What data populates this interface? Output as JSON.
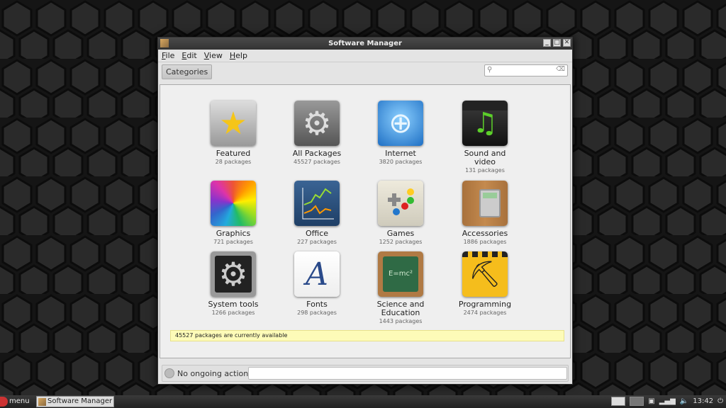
{
  "window": {
    "title": "Software Manager"
  },
  "menu": [
    "File",
    "Edit",
    "View",
    "Help"
  ],
  "toolbar": {
    "categories_label": "Categories",
    "search_placeholder": ""
  },
  "categories": [
    {
      "label": "Featured",
      "count": "28 packages",
      "icon": "star-icon"
    },
    {
      "label": "All Packages",
      "count": "45527 packages",
      "icon": "gear-icon"
    },
    {
      "label": "Internet",
      "count": "3820 packages",
      "icon": "globe-icon"
    },
    {
      "label": "Sound and video",
      "count": "131 packages",
      "icon": "clapper-music-icon"
    },
    {
      "label": "Graphics",
      "count": "721 packages",
      "icon": "color-wheel-icon"
    },
    {
      "label": "Office",
      "count": "227 packages",
      "icon": "chart-icon"
    },
    {
      "label": "Games",
      "count": "1252 packages",
      "icon": "gamepad-icon"
    },
    {
      "label": "Accessories",
      "count": "1886 packages",
      "icon": "calculator-icon"
    },
    {
      "label": "System tools",
      "count": "1266 packages",
      "icon": "gears-icon"
    },
    {
      "label": "Fonts",
      "count": "298 packages",
      "icon": "font-icon"
    },
    {
      "label": "Science and Education",
      "count": "1443 packages",
      "icon": "chalkboard-icon"
    },
    {
      "label": "Programming",
      "count": "2474 packages",
      "icon": "construction-icon"
    }
  ],
  "info_bar": "45527 packages are currently available",
  "status": {
    "text": "No ongoing actions"
  },
  "taskbar": {
    "menu_label": "menu",
    "task": "Software Manager",
    "clock": "13:42"
  }
}
